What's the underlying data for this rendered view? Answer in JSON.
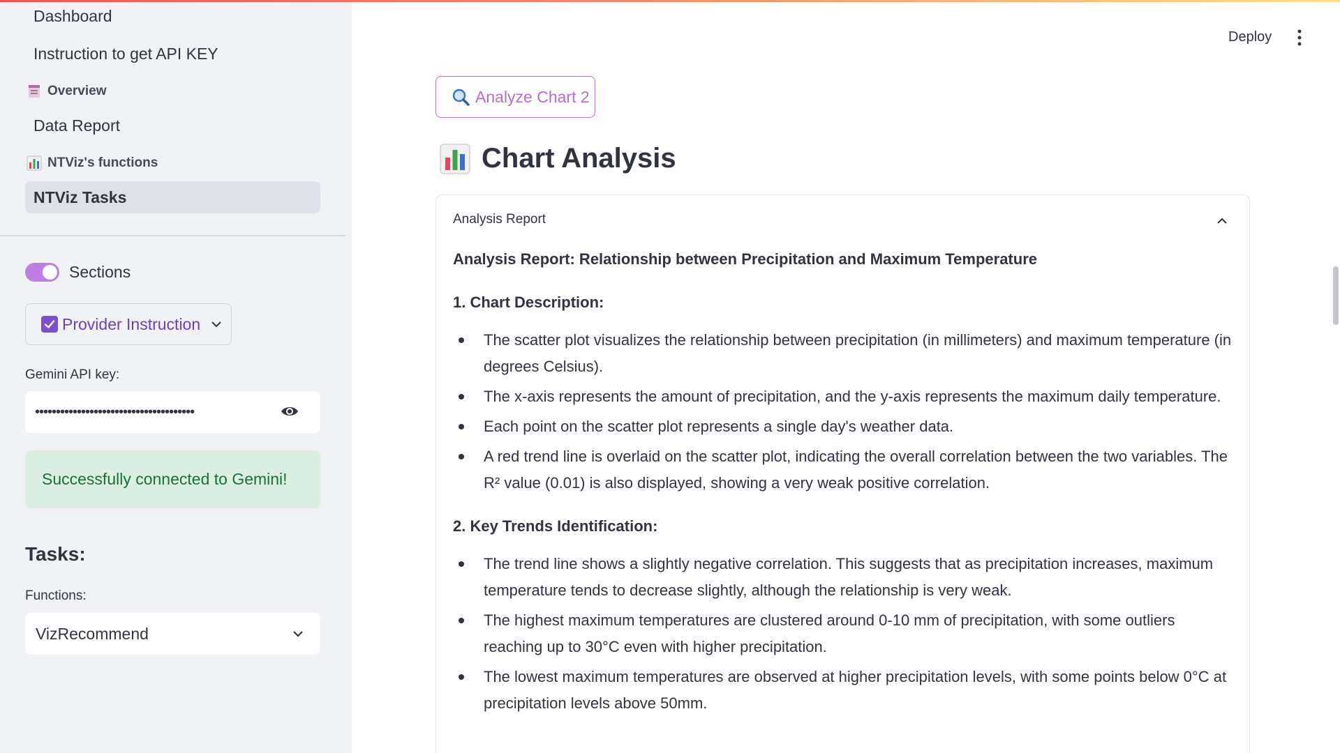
{
  "sidebar": {
    "nav": {
      "dashboard": "Dashboard",
      "instruction": "Instruction to get API KEY",
      "overview_header": "Overview",
      "data_report": "Data Report",
      "functions_header": "NTViz's functions",
      "ntviz_tasks": "NTViz Tasks"
    },
    "sections_toggle_label": "Sections",
    "provider_button": "Provider Instruction",
    "api_key_label": "Gemini API key:",
    "api_key_value": "••••••••••••••••••••••••••••••••••••••",
    "success_message": "Successfully connected to Gemini!",
    "tasks_heading": "Tasks:",
    "functions_label": "Functions:",
    "functions_selected": "VizRecommend"
  },
  "header": {
    "deploy": "Deploy"
  },
  "main": {
    "analyze_button": "Analyze Chart 2",
    "title": "Chart Analysis",
    "expander_title": "Analysis Report",
    "report": {
      "heading": "Analysis Report: Relationship between Precipitation and Maximum Temperature",
      "section1_title": "1. Chart Description:",
      "section1_items": [
        "The scatter plot visualizes the relationship between precipitation (in millimeters) and maximum temperature (in degrees Celsius).",
        "The x-axis represents the amount of precipitation, and the y-axis represents the maximum daily temperature.",
        "Each point on the scatter plot represents a single day's weather data.",
        "A red trend line is overlaid on the scatter plot, indicating the overall correlation between the two variables. The R² value (0.01) is also displayed, showing a very weak positive correlation."
      ],
      "section2_title": "2. Key Trends Identification:",
      "section2_items": [
        "The trend line shows a slightly negative correlation. This suggests that as precipitation increases, maximum temperature tends to decrease slightly, although the relationship is very weak.",
        "The highest maximum temperatures are clustered around 0-10 mm of precipitation, with some outliers reaching up to 30°C even with higher precipitation.",
        "The lowest maximum temperatures are observed at higher precipitation levels, with some points below 0°C at precipitation levels above 50mm."
      ]
    }
  },
  "colors": {
    "toggle_on": "#bf7ee3",
    "success_bg": "#dbefe3",
    "success_text": "#177233",
    "accent_purple": "#7b4fd1"
  }
}
